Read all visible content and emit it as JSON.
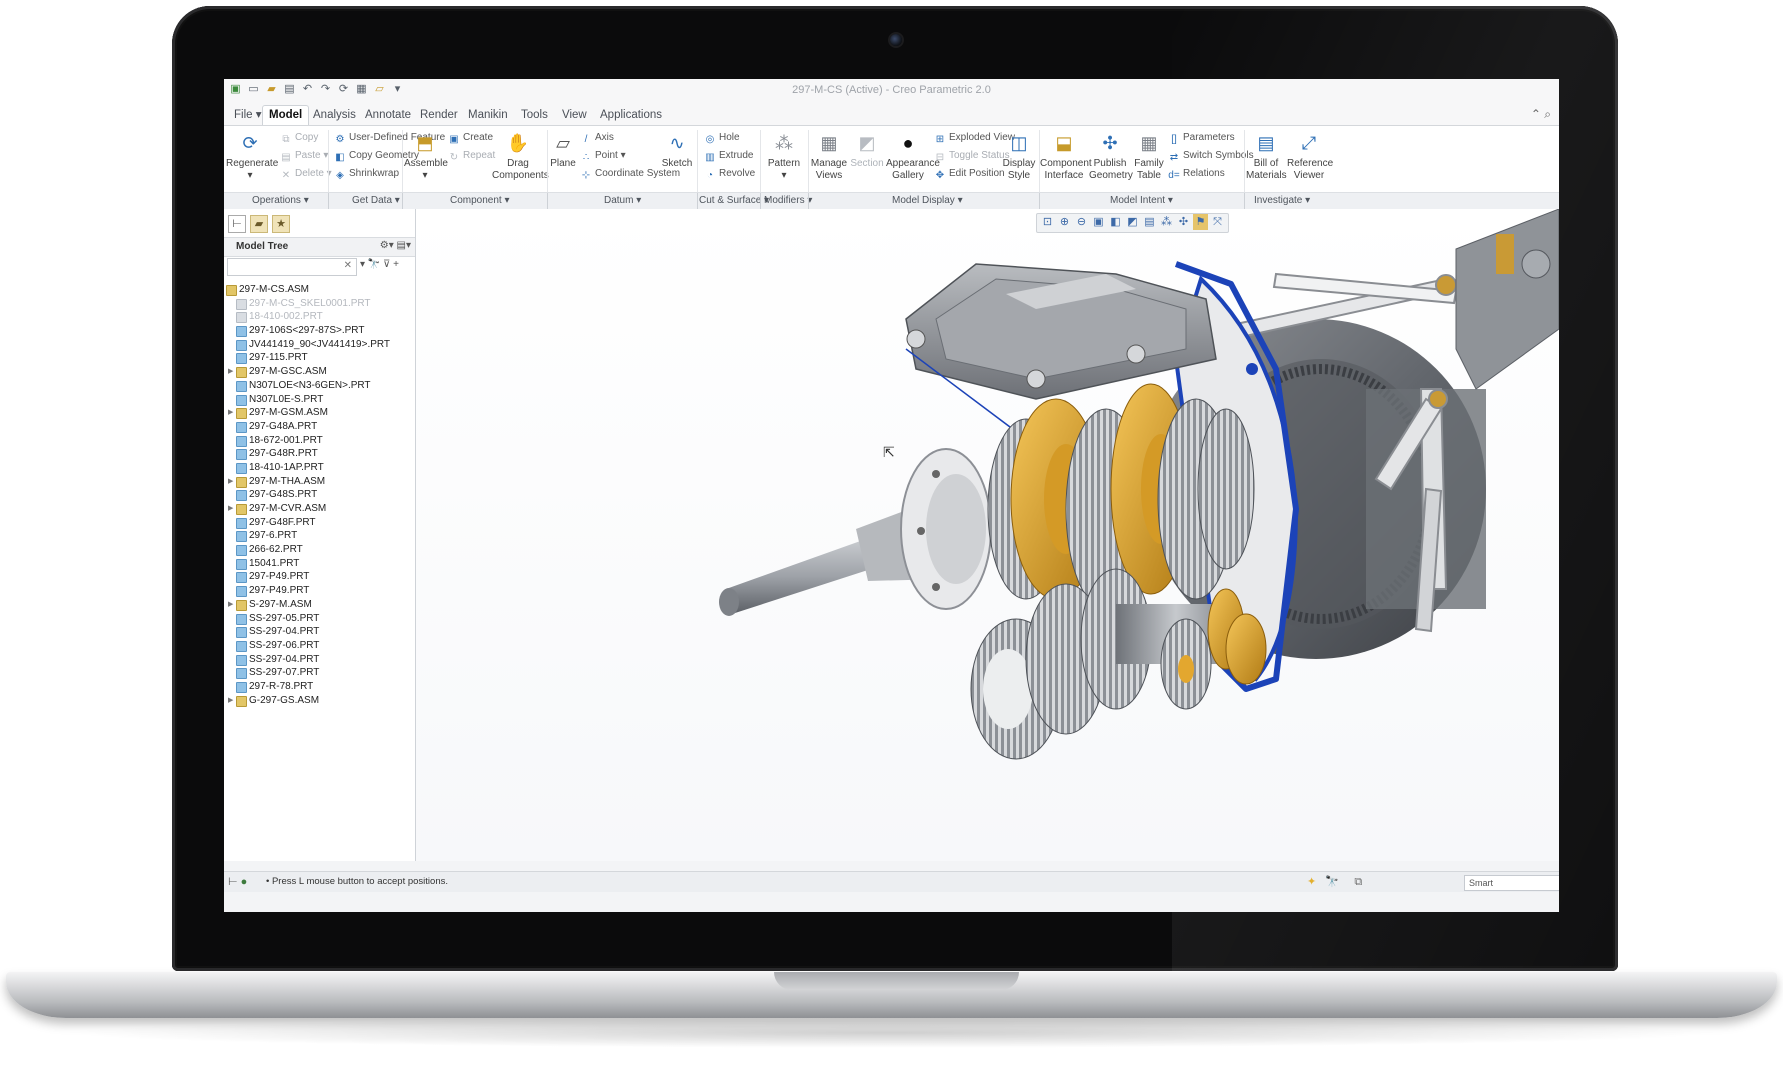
{
  "window": {
    "title": "297-M-CS (Active) - Creo Parametric 2.0"
  },
  "tabs": [
    {
      "label": "File ▾"
    },
    {
      "label": "Model"
    },
    {
      "label": "Analysis"
    },
    {
      "label": "Annotate"
    },
    {
      "label": "Render"
    },
    {
      "label": "Manikin"
    },
    {
      "label": "Tools"
    },
    {
      "label": "View"
    },
    {
      "label": "Applications"
    }
  ],
  "ribbon": {
    "regenerate": "Regenerate",
    "copy": "Copy",
    "paste": "Paste ▾",
    "delete": "Delete ▾",
    "user_defined_feature": "User-Defined Feature",
    "copy_geometry": "Copy Geometry",
    "shrinkwrap": "Shrinkwrap",
    "assemble": "Assemble",
    "create": "Create",
    "repeat": "Repeat",
    "drag_components": "Drag Components",
    "plane": "Plane",
    "axis": "Axis",
    "point": "Point ▾",
    "coordinate_system": "Coordinate System",
    "sketch": "Sketch",
    "hole": "Hole",
    "extrude": "Extrude",
    "revolve": "Revolve",
    "pattern": "Pattern",
    "manage_views": "Manage Views",
    "section": "Section",
    "appearance_gallery": "Appearance Gallery",
    "exploded_view": "Exploded View",
    "toggle_status": "Toggle Status",
    "edit_position": "Edit Position",
    "display_style": "Display Style",
    "component_interface": "Component Interface",
    "publish_geometry": "Publish Geometry",
    "family_table": "Family Table",
    "parameters": "Parameters",
    "switch_symbols": "Switch Symbols",
    "relations": "Relations",
    "bill_of_materials": "Bill of Materials",
    "reference_viewer": "Reference Viewer"
  },
  "groups": [
    {
      "label": "Operations ▾"
    },
    {
      "label": "Get Data ▾"
    },
    {
      "label": "Component ▾"
    },
    {
      "label": "Datum ▾"
    },
    {
      "label": "Cut & Surface ▾"
    },
    {
      "label": "Modifiers ▾"
    },
    {
      "label": "Model Display ▾"
    },
    {
      "label": "Model Intent ▾"
    },
    {
      "label": "Investigate ▾"
    }
  ],
  "model_tree": {
    "title": "Model Tree",
    "items": [
      {
        "label": "297-M-CS.ASM",
        "type": "asm",
        "level": 0,
        "expandable": false,
        "dim": false
      },
      {
        "label": "297-M-CS_SKEL0001.PRT",
        "type": "skel",
        "level": 1,
        "expandable": false,
        "dim": true
      },
      {
        "label": "18-410-002.PRT",
        "type": "skel",
        "level": 1,
        "expandable": false,
        "dim": true
      },
      {
        "label": "297-106S<297-87S>.PRT",
        "type": "prt",
        "level": 1,
        "expandable": false,
        "dim": false
      },
      {
        "label": "JV441419_90<JV441419>.PRT",
        "type": "prt",
        "level": 1,
        "expandable": false,
        "dim": false
      },
      {
        "label": "297-115.PRT",
        "type": "prt",
        "level": 1,
        "expandable": false,
        "dim": false
      },
      {
        "label": "297-M-GSC.ASM",
        "type": "asm",
        "level": 1,
        "expandable": true,
        "dim": false
      },
      {
        "label": "N307LOE<N3-6GEN>.PRT",
        "type": "prt",
        "level": 1,
        "expandable": false,
        "dim": false
      },
      {
        "label": "N307L0E-S.PRT",
        "type": "prt",
        "level": 1,
        "expandable": false,
        "dim": false
      },
      {
        "label": "297-M-GSM.ASM",
        "type": "asm",
        "level": 1,
        "expandable": true,
        "dim": false
      },
      {
        "label": "297-G48A.PRT",
        "type": "prt",
        "level": 1,
        "expandable": false,
        "dim": false
      },
      {
        "label": "18-672-001.PRT",
        "type": "prt",
        "level": 1,
        "expandable": false,
        "dim": false
      },
      {
        "label": "297-G48R.PRT",
        "type": "prt",
        "level": 1,
        "expandable": false,
        "dim": false
      },
      {
        "label": "18-410-1AP.PRT",
        "type": "prt",
        "level": 1,
        "expandable": false,
        "dim": false
      },
      {
        "label": "297-M-THA.ASM",
        "type": "asm",
        "level": 1,
        "expandable": true,
        "dim": false
      },
      {
        "label": "297-G48S.PRT",
        "type": "prt",
        "level": 1,
        "expandable": false,
        "dim": false
      },
      {
        "label": "297-M-CVR.ASM",
        "type": "asm",
        "level": 1,
        "expandable": true,
        "dim": false
      },
      {
        "label": "297-G48F.PRT",
        "type": "prt",
        "level": 1,
        "expandable": false,
        "dim": false
      },
      {
        "label": "297-6.PRT",
        "type": "prt",
        "level": 1,
        "expandable": false,
        "dim": false
      },
      {
        "label": "266-62.PRT",
        "type": "prt",
        "level": 1,
        "expandable": false,
        "dim": false
      },
      {
        "label": "15041.PRT",
        "type": "prt",
        "level": 1,
        "expandable": false,
        "dim": false
      },
      {
        "label": "297-P49.PRT",
        "type": "prt",
        "level": 1,
        "expandable": false,
        "dim": false
      },
      {
        "label": "297-P49.PRT",
        "type": "prt",
        "level": 1,
        "expandable": false,
        "dim": false
      },
      {
        "label": "S-297-M.ASM",
        "type": "asm",
        "level": 1,
        "expandable": true,
        "dim": false
      },
      {
        "label": "SS-297-05.PRT",
        "type": "prt",
        "level": 1,
        "expandable": false,
        "dim": false
      },
      {
        "label": "SS-297-04.PRT",
        "type": "prt",
        "level": 1,
        "expandable": false,
        "dim": false
      },
      {
        "label": "SS-297-06.PRT",
        "type": "prt",
        "level": 1,
        "expandable": false,
        "dim": false
      },
      {
        "label": "SS-297-04.PRT",
        "type": "prt",
        "level": 1,
        "expandable": false,
        "dim": false
      },
      {
        "label": "SS-297-07.PRT",
        "type": "prt",
        "level": 1,
        "expandable": false,
        "dim": false
      },
      {
        "label": "297-R-78.PRT",
        "type": "prt",
        "level": 1,
        "expandable": false,
        "dim": false
      },
      {
        "label": "G-297-GS.ASM",
        "type": "asm",
        "level": 1,
        "expandable": true,
        "dim": false
      }
    ]
  },
  "status": {
    "message": "• Press L mouse button to accept positions.",
    "filter": "Smart"
  },
  "colors": {
    "accent": "#2e6fb5",
    "gear_gold": "#e3a72f",
    "gasket_blue": "#1c43b8",
    "metal_gray": "#9a9ea4"
  }
}
